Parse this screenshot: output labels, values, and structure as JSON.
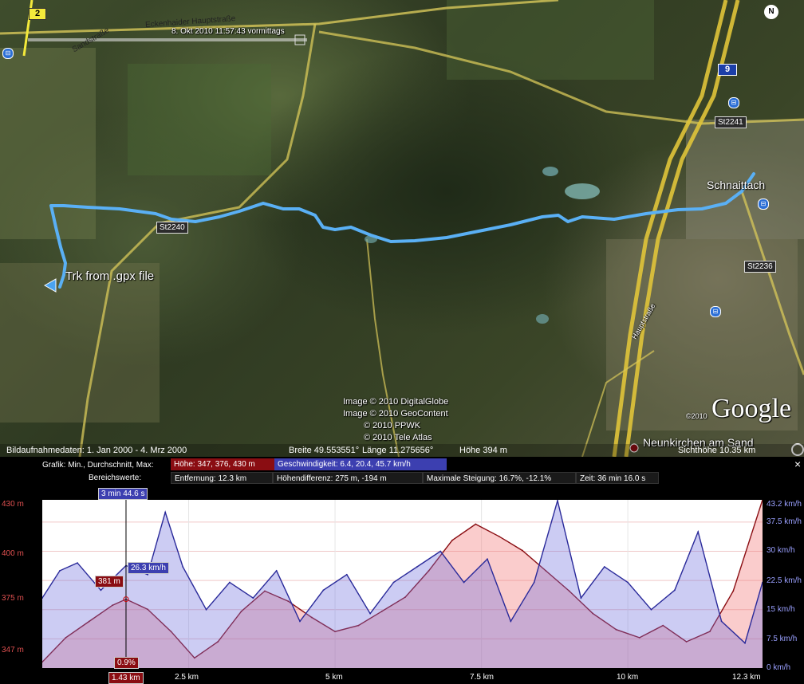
{
  "map": {
    "track_label": "Trk from .gpx file",
    "timestamp": "8. Okt 2010  11:57:43 vormittags",
    "road_labels": [
      {
        "text": "Eckenhaider Hauptstraße"
      },
      {
        "text": "Sandstraße"
      },
      {
        "text": "Hauptstraße"
      }
    ],
    "shields": {
      "b2": "2",
      "a9": "9",
      "st2241": "St2241",
      "st2240": "St2240",
      "st2236": "St2236"
    },
    "towns": {
      "schnaittach": "Schnaittach",
      "neunkirchen": "Neunkirchen am Sand"
    },
    "compass": "N",
    "credits": [
      "Image © 2010 DigitalGlobe",
      "Image © 2010 GeoContent",
      "© 2010 PPWK",
      "© 2010 Tele Atlas"
    ],
    "google_year": "©2010",
    "google_logo": "Google",
    "track_color": "#5ab0f5"
  },
  "status": {
    "imagery_dates": "Bildaufnahmedaten:  1. Jan 2000 -  4. Mrz 2000",
    "lat": "Breite   49.553551°",
    "lon": "Länge   11.275656°",
    "elev": "Höhe  394 m",
    "eye": "Sichthöhe   10.35 km"
  },
  "profile": {
    "close": "×",
    "graph_label": "Grafik: Min., Durchschnitt, Max:",
    "elevation_stats": "Höhe: 347, 376, 430 m",
    "speed_stats": "Geschwindigkeit: 6.4, 20.4, 45.7 km/h",
    "range_label": "Bereichswerte:",
    "distance": "Entfernung: 12.3 km",
    "height_diff": "Höhendifferenz: 275 m, -194 m",
    "max_slope": "Maximale Steigung: 16.7%, -12.1%",
    "time": "Zeit: 36 min 16.0 s",
    "cursor_time": "3 min 44.6 s",
    "cursor_speed": "26.3 km/h",
    "cursor_elev": "381 m",
    "cursor_slope": "0.9%",
    "cursor_dist": "1.43 km",
    "left_axis": [
      "430 m",
      "400 m",
      "375 m",
      "347 m"
    ],
    "right_axis": [
      "43.2 km/h",
      "37.5 km/h",
      "30 km/h",
      "22.5 km/h",
      "15 km/h",
      "7.5 km/h",
      "0 km/h"
    ],
    "x_axis": [
      "2.5 km",
      "5 km",
      "7.5 km",
      "10 km",
      "12.3 km"
    ],
    "elev_color": "#8a0d12",
    "speed_color": "#2a2a9a"
  },
  "chart_data": {
    "type": "area",
    "xlabel": "",
    "xlim": [
      0,
      12.3
    ],
    "series": [
      {
        "name": "Höhe",
        "unit": "m",
        "ylim": [
          347,
          430
        ],
        "x": [
          0,
          0.4,
          0.8,
          1.2,
          1.43,
          1.8,
          2.2,
          2.6,
          3.0,
          3.4,
          3.8,
          4.2,
          4.6,
          5.0,
          5.4,
          5.8,
          6.2,
          6.6,
          7.0,
          7.4,
          7.8,
          8.2,
          8.6,
          9.0,
          9.4,
          9.8,
          10.2,
          10.6,
          11.0,
          11.4,
          11.8,
          12.3
        ],
        "values": [
          350,
          362,
          370,
          378,
          381,
          376,
          365,
          352,
          360,
          375,
          385,
          380,
          372,
          365,
          368,
          375,
          382,
          395,
          410,
          418,
          412,
          405,
          395,
          385,
          374,
          366,
          362,
          368,
          360,
          365,
          385,
          430
        ]
      },
      {
        "name": "Geschwindigkeit",
        "unit": "km/h",
        "ylim": [
          0,
          43.2
        ],
        "x": [
          0,
          0.3,
          0.6,
          1.0,
          1.43,
          1.8,
          2.1,
          2.4,
          2.8,
          3.2,
          3.6,
          4.0,
          4.4,
          4.8,
          5.2,
          5.6,
          6.0,
          6.4,
          6.8,
          7.2,
          7.6,
          8.0,
          8.4,
          8.8,
          9.2,
          9.6,
          10.0,
          10.4,
          10.8,
          11.2,
          11.6,
          12.0,
          12.3
        ],
        "values": [
          18,
          25,
          27,
          20,
          26.3,
          24,
          40,
          26,
          15,
          22,
          18,
          25,
          12,
          20,
          24,
          14,
          22,
          26,
          30,
          22,
          28,
          12,
          22,
          43,
          18,
          26,
          22,
          15,
          20,
          35,
          12,
          6.4,
          22
        ]
      }
    ]
  }
}
